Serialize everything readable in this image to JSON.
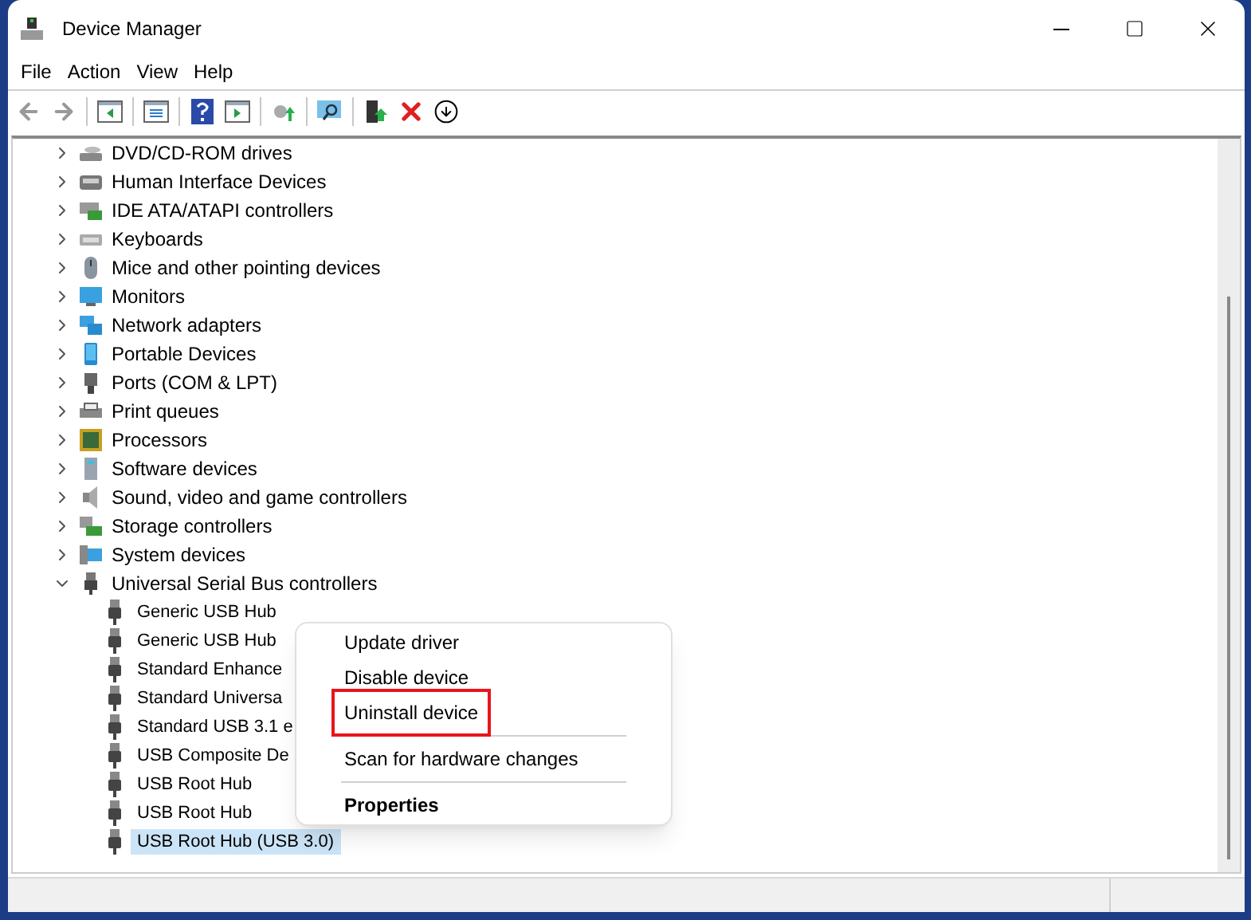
{
  "window": {
    "title": "Device Manager"
  },
  "menu": [
    "File",
    "Action",
    "View",
    "Help"
  ],
  "tree": [
    {
      "label": "DVD/CD-ROM drives",
      "expanded": false,
      "selected": false
    },
    {
      "label": "Human Interface Devices",
      "expanded": false,
      "selected": false
    },
    {
      "label": "IDE ATA/ATAPI controllers",
      "expanded": false,
      "selected": false
    },
    {
      "label": "Keyboards",
      "expanded": false,
      "selected": false
    },
    {
      "label": "Mice and other pointing devices",
      "expanded": false,
      "selected": false
    },
    {
      "label": "Monitors",
      "expanded": false,
      "selected": false
    },
    {
      "label": "Network adapters",
      "expanded": false,
      "selected": false
    },
    {
      "label": "Portable Devices",
      "expanded": false,
      "selected": false
    },
    {
      "label": "Ports (COM & LPT)",
      "expanded": false,
      "selected": false
    },
    {
      "label": "Print queues",
      "expanded": false,
      "selected": false
    },
    {
      "label": "Processors",
      "expanded": false,
      "selected": false
    },
    {
      "label": "Software devices",
      "expanded": false,
      "selected": false
    },
    {
      "label": "Sound, video and game controllers",
      "expanded": false,
      "selected": false
    },
    {
      "label": "Storage controllers",
      "expanded": false,
      "selected": false
    },
    {
      "label": "System devices",
      "expanded": false,
      "selected": false
    },
    {
      "label": "Universal Serial Bus controllers",
      "expanded": true,
      "selected": false,
      "children": [
        {
          "label": "Generic USB Hub",
          "selected": false
        },
        {
          "label": "Generic USB Hub",
          "selected": false
        },
        {
          "label": "Standard Enhance",
          "selected": false
        },
        {
          "label": "Standard Universa",
          "selected": false
        },
        {
          "label": "Standard USB 3.1 e",
          "selected": false
        },
        {
          "label": "USB Composite De",
          "selected": false
        },
        {
          "label": "USB Root Hub",
          "selected": false
        },
        {
          "label": "USB Root Hub",
          "selected": false
        },
        {
          "label": "USB Root Hub (USB 3.0)",
          "selected": true
        }
      ]
    }
  ],
  "context_menu": [
    {
      "kind": "item",
      "label": "Update driver",
      "outlined": false,
      "bold": false
    },
    {
      "kind": "item",
      "label": "Disable device",
      "outlined": false,
      "bold": false
    },
    {
      "kind": "item",
      "label": "Uninstall device",
      "outlined": true,
      "bold": false
    },
    {
      "kind": "separator"
    },
    {
      "kind": "item",
      "label": "Scan for hardware changes",
      "outlined": false,
      "bold": false
    },
    {
      "kind": "separator"
    },
    {
      "kind": "item",
      "label": "Properties",
      "outlined": false,
      "bold": true
    }
  ]
}
